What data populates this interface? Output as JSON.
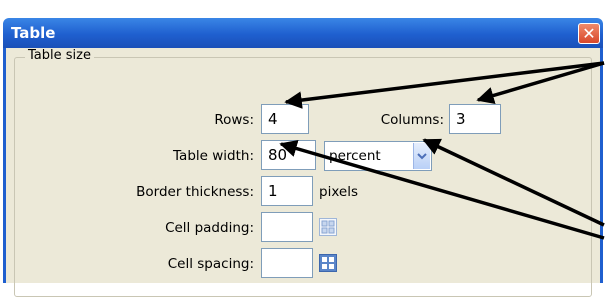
{
  "dialog": {
    "title": "Table",
    "close_label": "✕"
  },
  "table_size": {
    "legend": "Table size",
    "rows_label": "Rows:",
    "rows_value": "4",
    "columns_label": "Columns:",
    "columns_value": "3",
    "width_label": "Table width:",
    "width_value": "80",
    "width_unit": "percent",
    "border_label": "Border thickness:",
    "border_value": "1",
    "border_unit": "pixels",
    "padding_label": "Cell padding:",
    "padding_value": "",
    "spacing_label": "Cell spacing:",
    "spacing_value": ""
  },
  "icons": {
    "padding_icon": "cell-padding-icon",
    "spacing_icon": "cell-spacing-icon",
    "dropdown_icon": "chevron-down-icon",
    "close_icon": "close-icon"
  },
  "colors": {
    "title_bar": "#1f5fcf",
    "dialog_bg": "#ece9d8",
    "close_button": "#d8472a",
    "field_border": "#7f9db9"
  }
}
